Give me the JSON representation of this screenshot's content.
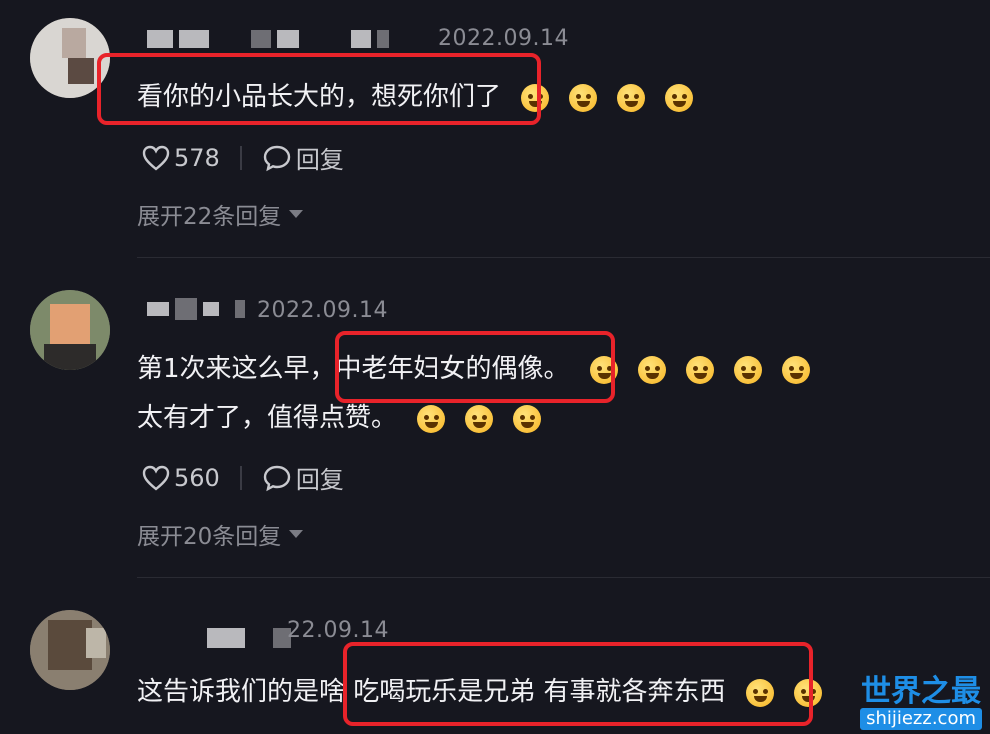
{
  "comments": [
    {
      "date": "2022.09.14",
      "text_lines": [
        "看你的小品长大的，想死你们了"
      ],
      "likes": "578",
      "reply_label": "回复",
      "expand_label": "展开22条回复"
    },
    {
      "date": "2022.09.14",
      "text_lines": [
        "第1次来这么早，中老年妇女的偶像。",
        "太有才了，值得点赞。"
      ],
      "likes": "560",
      "reply_label": "回复",
      "expand_label": "展开20条回复"
    },
    {
      "date": "22.09.14",
      "text_lines": [
        "这告诉我们的是啥 吃喝玩乐是兄弟 有事就各奔东西"
      ]
    }
  ],
  "colors": {
    "highlight": "#e8232a",
    "background": "#16171f",
    "watermark": "#1e8ee6"
  },
  "watermark": {
    "line1": "世界之最",
    "line2": "shijiezz.com"
  }
}
